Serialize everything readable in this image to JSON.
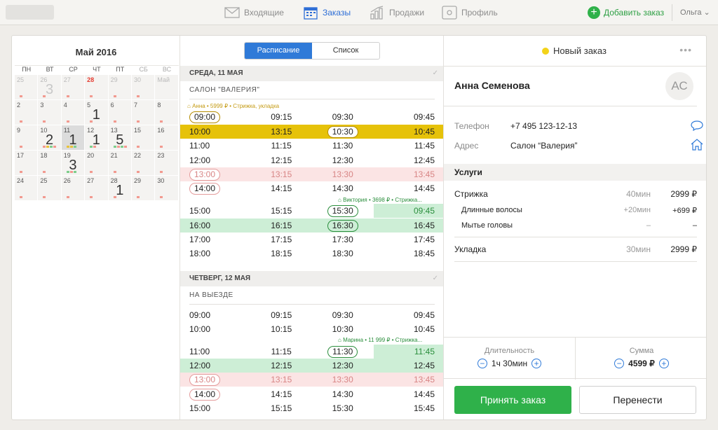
{
  "nav": {
    "inbox": "Входящие",
    "orders": "Заказы",
    "sales": "Продажи",
    "profile": "Профиль",
    "add_order": "Добавить заказ",
    "user": "Ольга"
  },
  "calendar": {
    "title": "Май 2016",
    "weekdays": [
      "ПН",
      "ВТ",
      "СР",
      "ЧТ",
      "ПТ",
      "СБ",
      "ВС"
    ],
    "weeks": [
      [
        {
          "d": "25",
          "mo": true
        },
        {
          "d": "26",
          "mo": true,
          "big": "3"
        },
        {
          "d": "27",
          "mo": true
        },
        {
          "d": "28",
          "red": true
        },
        {
          "d": "29",
          "mo": true
        },
        {
          "d": "30",
          "mo": true
        },
        {
          "d": "Май",
          "mo": true
        }
      ],
      [
        {
          "d": "2"
        },
        {
          "d": "3"
        },
        {
          "d": "4"
        },
        {
          "d": "5",
          "big": "1"
        },
        {
          "d": "6"
        },
        {
          "d": "7"
        },
        {
          "d": "8"
        }
      ],
      [
        {
          "d": "9"
        },
        {
          "d": "10",
          "big": "2"
        },
        {
          "d": "11",
          "big": "1",
          "today": true
        },
        {
          "d": "12",
          "big": "1"
        },
        {
          "d": "13",
          "big": "5"
        },
        {
          "d": "15"
        },
        {
          "d": "16"
        }
      ],
      [
        {
          "d": "17"
        },
        {
          "d": "18"
        },
        {
          "d": "19",
          "big": "3"
        },
        {
          "d": "20"
        },
        {
          "d": "21"
        },
        {
          "d": "22"
        },
        {
          "d": "23"
        }
      ],
      [
        {
          "d": "24"
        },
        {
          "d": "25"
        },
        {
          "d": "26"
        },
        {
          "d": "27"
        },
        {
          "d": "28",
          "big": "1"
        },
        {
          "d": "29"
        },
        {
          "d": "30"
        }
      ]
    ]
  },
  "schedule": {
    "tabs": [
      "Расписание",
      "Список"
    ],
    "day1": {
      "header": "СРЕДА, 11 МАЯ",
      "place": "САЛОН \"ВАЛЕРИЯ\"",
      "booking1": "Анна • 5999 ₽ • Стрижка, укладка",
      "booking2": "Виктория • 3698 ₽ • Стрижка...",
      "rows": [
        [
          "09:00",
          "09:15",
          "09:30",
          "09:45"
        ],
        [
          "10:00",
          "13:15",
          "10:30",
          "10:45"
        ],
        [
          "11:00",
          "11:15",
          "11:30",
          "11:45"
        ],
        [
          "12:00",
          "12:15",
          "12:30",
          "12:45"
        ],
        [
          "13:00",
          "13:15",
          "13:30",
          "13:45"
        ],
        [
          "14:00",
          "14:15",
          "14:30",
          "14:45"
        ],
        [
          "15:00",
          "15:15",
          "15:30",
          "09:45"
        ],
        [
          "16:00",
          "16:15",
          "16:30",
          "16:45"
        ],
        [
          "17:00",
          "17:15",
          "17:30",
          "17:45"
        ],
        [
          "18:00",
          "18:15",
          "18:30",
          "18:45"
        ]
      ]
    },
    "day2": {
      "header": "ЧЕТВЕРГ, 12 МАЯ",
      "place": "НА ВЫЕЗДЕ",
      "booking": "Марина • 11 999 ₽ • Стрижка...",
      "rows": [
        [
          "09:00",
          "09:15",
          "09:30",
          "09:45"
        ],
        [
          "10:00",
          "10:15",
          "10:30",
          "10:45"
        ],
        [
          "11:00",
          "11:15",
          "11:30",
          "11:45"
        ],
        [
          "12:00",
          "12:15",
          "12:30",
          "12:45"
        ],
        [
          "13:00",
          "13:15",
          "13:30",
          "13:45"
        ],
        [
          "14:00",
          "14:15",
          "14:30",
          "14:45"
        ],
        [
          "15:00",
          "15:15",
          "15:30",
          "15:45"
        ]
      ]
    }
  },
  "order": {
    "status": "Новый заказ",
    "client": "Анна Семенова",
    "initials": "АС",
    "phone_label": "Телефон",
    "phone": "+7 495 123-12-13",
    "address_label": "Адрес",
    "address": "Салон “Валерия”",
    "services_title": "Услуги",
    "services": [
      {
        "name": "Стрижка",
        "time": "40мин",
        "price": "2999 ₽"
      },
      {
        "name": "Длинные волосы",
        "time": "+20мин",
        "price": "+699 ₽"
      },
      {
        "name": "Мытье головы",
        "time": "–",
        "price": "–"
      },
      {
        "name": "Укладка",
        "time": "30мин",
        "price": "2999 ₽"
      }
    ],
    "duration_label": "Длительность",
    "duration": "1ч 30мин",
    "sum_label": "Сумма",
    "sum": "4599 ₽",
    "accept": "Принять заказ",
    "move": "Перенести"
  }
}
